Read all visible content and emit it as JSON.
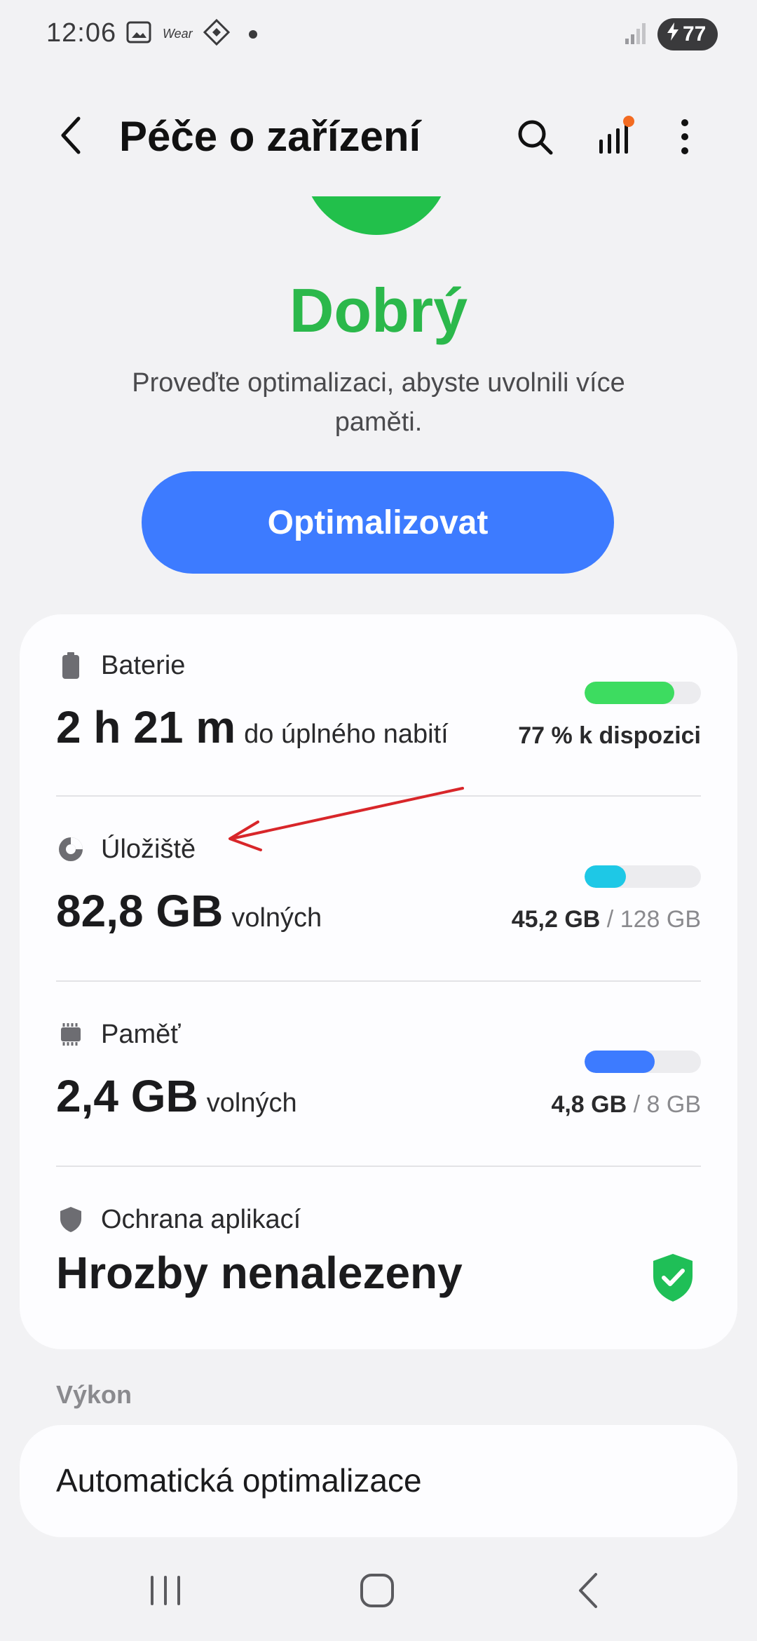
{
  "status_bar": {
    "time": "12:06",
    "wear_label": "Wear",
    "battery_level": "77"
  },
  "app_bar": {
    "title": "Péče o zařízení",
    "back_icon": "chevron-left-icon",
    "search_icon": "search-icon",
    "stats_icon": "signal-bars-icon",
    "more_icon": "more-vertical-icon"
  },
  "header": {
    "status": "Dobrý",
    "description": "Proveďte optimalizaci, abyste uvolnili více paměti.",
    "button_label": "Optimalizovat"
  },
  "items": {
    "battery": {
      "label": "Baterie",
      "value": "2 h 21 m",
      "suffix": "do úplného nabití",
      "right_strong": "77 % k dispozici",
      "right_muted": "",
      "fill_fraction": 0.77,
      "color": "#3ddc60"
    },
    "storage": {
      "label": "Úložiště",
      "value": "82,8 GB",
      "suffix": "volných",
      "right_strong": "45,2 GB",
      "right_muted": " / 128 GB",
      "fill_fraction": 0.353,
      "color": "#1ec8e6"
    },
    "memory": {
      "label": "Paměť",
      "value": "2,4 GB",
      "suffix": "volných",
      "right_strong": "4,8 GB",
      "right_muted": " / 8 GB",
      "fill_fraction": 0.6,
      "color": "#3d7bff"
    },
    "protection": {
      "label": "Ochrana aplikací",
      "value": "Hrozby nenalezeny",
      "status_icon": "shield-check-icon",
      "status_color": "#1fbf57"
    }
  },
  "performance": {
    "section_label": "Výkon",
    "auto_label": "Automatická optimalizace"
  },
  "colors": {
    "accent": "#3d7bff",
    "good": "#2bb84b",
    "annotation": "#d8262a"
  }
}
